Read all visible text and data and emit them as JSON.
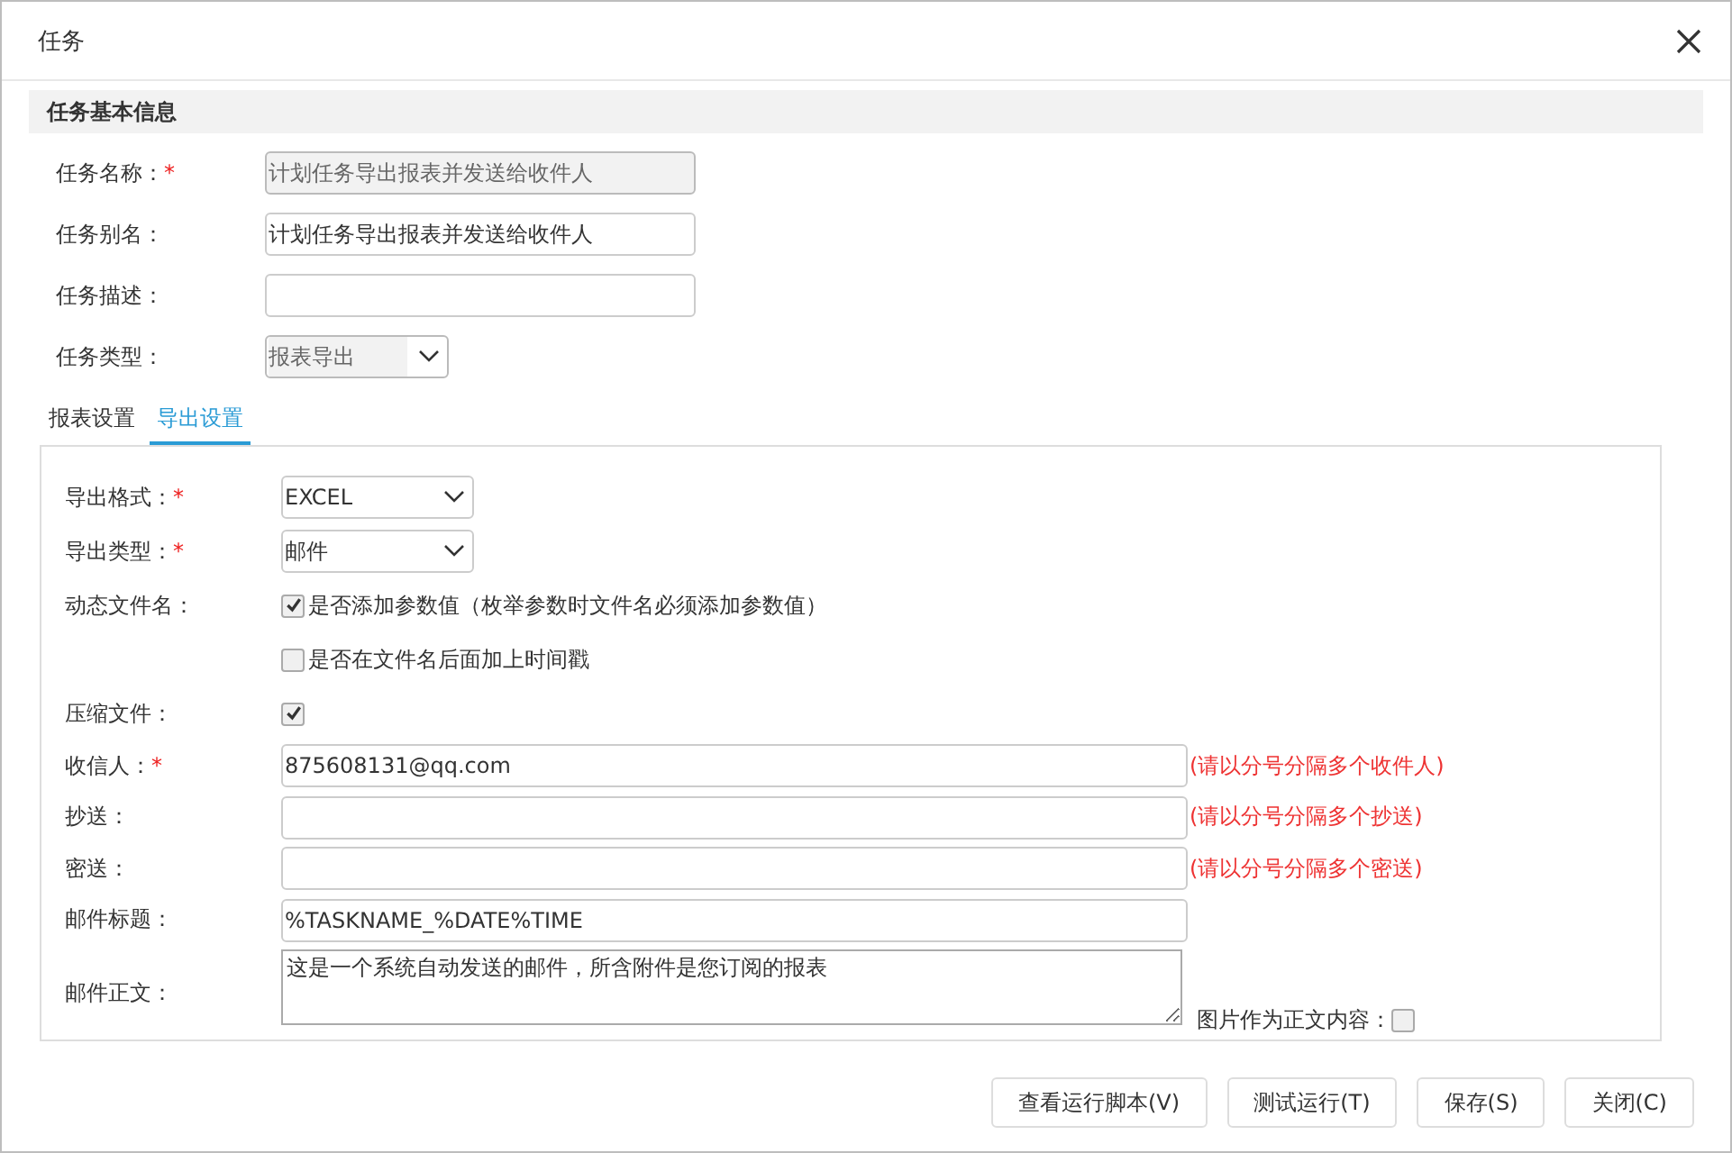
{
  "window": {
    "title": "任务"
  },
  "basic_section": {
    "title": "任务基本信息",
    "fields": [
      {
        "kind": "input",
        "label": "任务名称：",
        "mark": "*",
        "value": "计划任务导出报表并发送给收件人",
        "disabled": true
      },
      {
        "kind": "input",
        "label": "任务别名：",
        "value": "计划任务导出报表并发送给收件人",
        "disabled": false
      },
      {
        "kind": "input",
        "label": "任务描述：",
        "disabled": false
      },
      {
        "kind": "select",
        "label": "任务类型：",
        "value": "报表导出",
        "disabled": true
      }
    ]
  },
  "tabs": [
    {
      "label": "报表设置",
      "selected": false
    },
    {
      "label": "导出设置",
      "selected": true
    }
  ],
  "export_fields": [
    {
      "kind": "select",
      "label": "导出格式：",
      "mark": "*",
      "value": "EXCEL",
      "disabled": false
    },
    {
      "kind": "select",
      "label": "导出类型：",
      "mark": "*",
      "value": "邮件",
      "disabled": false
    },
    {
      "kind": "checkbox",
      "label": "动态文件名：",
      "checked": true,
      "text": "是否添加参数值（枚举参数时文件名必须添加参数值）"
    },
    {
      "kind": "checkbox",
      "checked": false,
      "text": "是否在文件名后面加上时间戳"
    },
    {
      "kind": "checkbox",
      "label": "压缩文件：",
      "checked": true
    },
    {
      "kind": "wide_input",
      "label": "收信人：",
      "mark": "*",
      "value": "875608131@qq.com",
      "hint": "(请以分号分隔多个收件人)"
    },
    {
      "kind": "wide_input",
      "label": "抄送：",
      "hint": "(请以分号分隔多个抄送)"
    },
    {
      "kind": "wide_input",
      "label": "密送：",
      "hint": "(请以分号分隔多个密送)"
    },
    {
      "kind": "wide_input",
      "label": "邮件标题：",
      "value": "%TASKNAME_%DATE%TIME"
    },
    {
      "kind": "textarea",
      "label": "邮件正文：",
      "value": "这是一个系统自动发送的邮件，所含附件是您订阅的报表",
      "option_label": "图片作为正文内容：",
      "option_checked": false
    }
  ],
  "buttons": [
    "查看运行脚本(V)",
    "测试运行(T)",
    "保存(S)",
    "关闭(C)"
  ]
}
